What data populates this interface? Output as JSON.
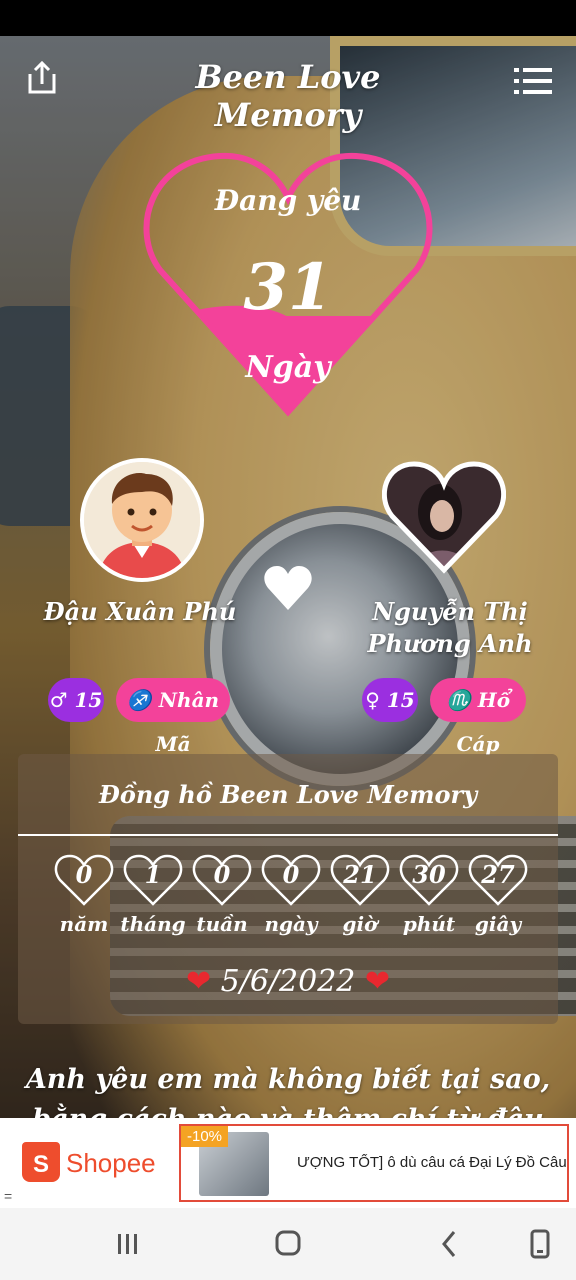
{
  "app": {
    "title": "Been Love Memory"
  },
  "counter": {
    "top_label": "Đang yêu",
    "count": "31",
    "unit": "Ngày"
  },
  "couple": {
    "left": {
      "name": "Đậu Xuân Phú",
      "age": "♂ 15",
      "zodiac": "♐ Nhân Mã"
    },
    "right": {
      "name": "Nguyễn Thị Phương Anh",
      "age": "♀ 15",
      "zodiac": "♏ Hổ Cáp"
    }
  },
  "clock": {
    "title": "Đồng hồ Been Love Memory",
    "units": [
      {
        "value": "0",
        "label": "năm"
      },
      {
        "value": "1",
        "label": "tháng"
      },
      {
        "value": "0",
        "label": "tuần"
      },
      {
        "value": "0",
        "label": "ngày"
      },
      {
        "value": "21",
        "label": "giờ"
      },
      {
        "value": "30",
        "label": "phút"
      },
      {
        "value": "27",
        "label": "giây"
      }
    ],
    "date": "5/6/2022"
  },
  "quote": "Anh yêu em mà không biết tại sao, bằng cách nào và thậm chí từ đâu",
  "ad": {
    "brand": "Shopee",
    "badge": "-10%",
    "text": "ƯỢNG TỐT] ô dù câu cá Đại Lý Đồ Câu Cá ớ"
  },
  "colors": {
    "pink": "#f3429a",
    "purple": "#9b2fe0",
    "heart_red": "#e8282f",
    "shopee": "#ee4d2d"
  }
}
